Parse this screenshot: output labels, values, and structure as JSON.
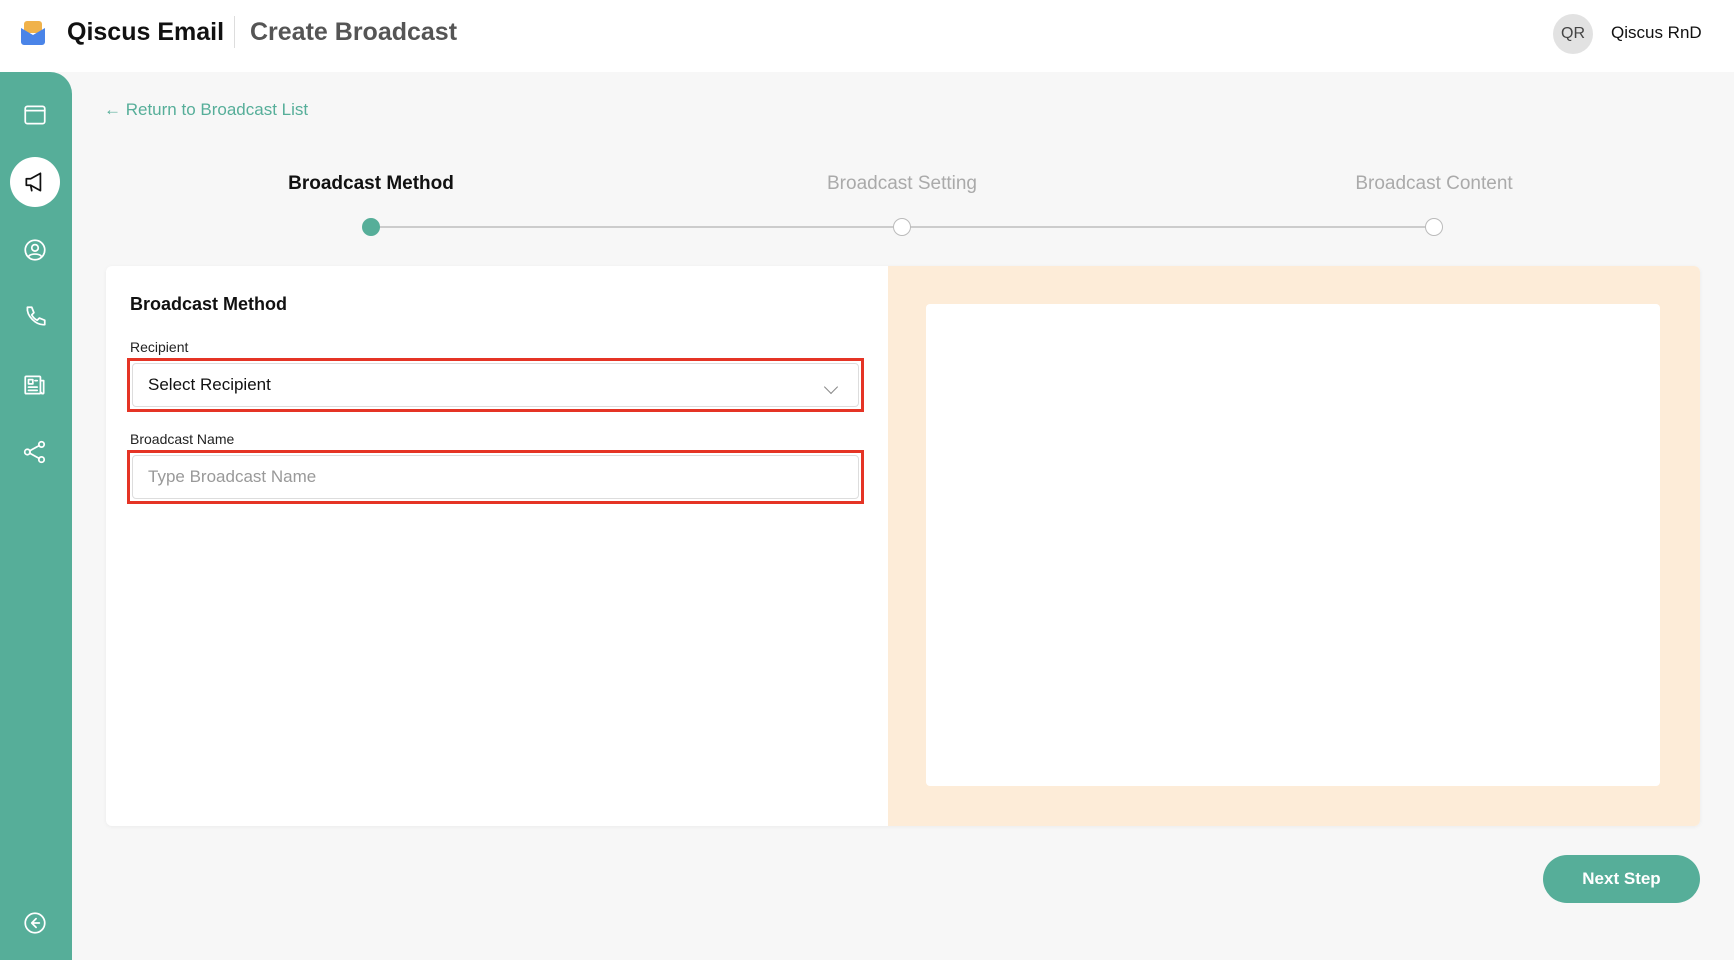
{
  "header": {
    "app_title": "Qiscus Email",
    "page_title": "Create Broadcast",
    "avatar_initials": "QR",
    "user_name": "Qiscus RnD"
  },
  "sidebar": {
    "items": [
      {
        "icon": "window-icon"
      },
      {
        "icon": "megaphone-icon",
        "active": true
      },
      {
        "icon": "user-circle-icon"
      },
      {
        "icon": "phone-icon"
      },
      {
        "icon": "newspaper-icon"
      },
      {
        "icon": "share-icon"
      },
      {
        "icon": "collapse-icon"
      }
    ]
  },
  "back_link": "← Return to Broadcast List",
  "steps": [
    {
      "label": "Broadcast Method",
      "active": true
    },
    {
      "label": "Broadcast Setting",
      "active": false
    },
    {
      "label": "Broadcast Content",
      "active": false
    }
  ],
  "form": {
    "title": "Broadcast Method",
    "recipient_label": "Recipient",
    "recipient_value": "Select Recipient",
    "name_label": "Broadcast Name",
    "name_placeholder": "Type Broadcast Name"
  },
  "next_button": "Next Step",
  "colors": {
    "accent": "#56ae99",
    "highlight": "#e53425",
    "preview_bg": "#fdecd8"
  }
}
